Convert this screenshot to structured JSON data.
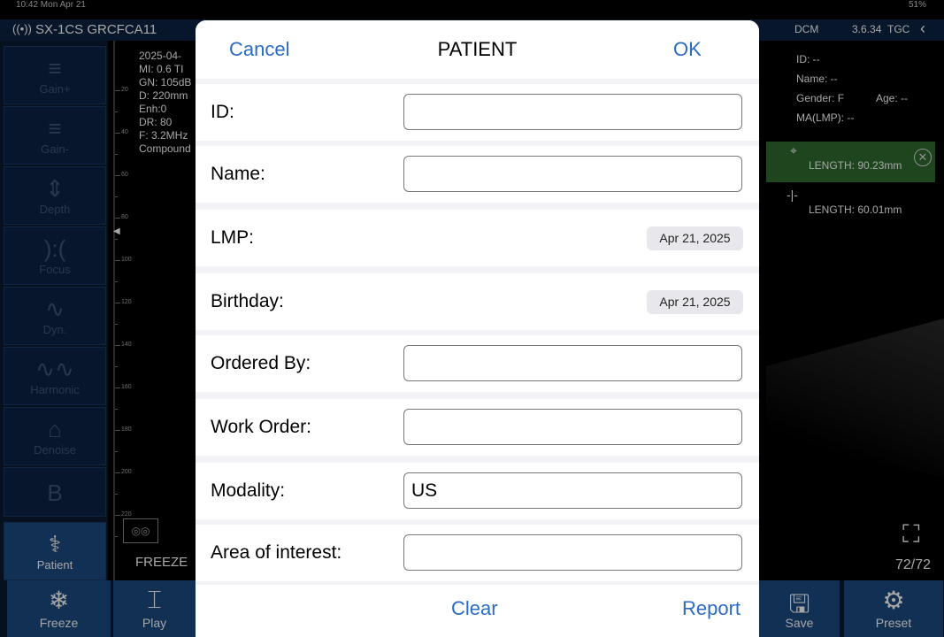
{
  "status_bar": {
    "time": "10:42  Mon Apr 21",
    "battery": "51%"
  },
  "topbar": {
    "device": "SX-1CS GRCFCA11",
    "dcm": "DCM",
    "version": "3.6.34",
    "tgc": "TGC"
  },
  "left_buttons": [
    {
      "label": "Gain+",
      "icon": "gain-plus-icon",
      "glyph": "≡"
    },
    {
      "label": "Gain-",
      "icon": "gain-minus-icon",
      "glyph": "≡"
    },
    {
      "label": "Depth",
      "icon": "depth-icon",
      "glyph": "⇕"
    },
    {
      "label": "Focus",
      "icon": "focus-icon",
      "glyph": "):("
    },
    {
      "label": "Dyn.",
      "icon": "dynamic-range-icon",
      "glyph": "∿"
    },
    {
      "label": "Harmonic",
      "icon": "harmonic-icon",
      "glyph": "∿∿"
    },
    {
      "label": "Denoise",
      "icon": "denoise-icon",
      "glyph": "⌂"
    },
    {
      "label": "B",
      "icon": "b-mode-icon",
      "glyph": "B"
    },
    {
      "label": "Patient",
      "icon": "patient-icon",
      "glyph": "⚕"
    }
  ],
  "scan_params": {
    "date": "2025-04-",
    "mi_ti": "MI: 0.6  TI",
    "gn": "GN: 105dB",
    "d": "D: 220mm",
    "enh": "Enh:0",
    "dr": "DR: 80",
    "f": "F: 3.2MHz",
    "compound": "Compound"
  },
  "ruler_labels": [
    "20",
    "40",
    "60",
    "80",
    "100",
    "120",
    "140",
    "160",
    "180",
    "200",
    "220"
  ],
  "freeze_status": "FREEZE",
  "patient_info": {
    "id": "ID: --",
    "name": "Name: --",
    "gender": "Gender: F",
    "age": "Age: --",
    "ma": "MA(LMP): --"
  },
  "measurements": [
    {
      "symbol": "-̵○-",
      "text": "LENGTH: 90.23mm"
    },
    {
      "symbol": "-|-",
      "text": "LENGTH: 60.01mm"
    }
  ],
  "frame_counter": "72/72",
  "bottom_buttons": [
    {
      "label": "Freeze",
      "icon": "snowflake-icon",
      "glyph": "❄"
    },
    {
      "label": "Play",
      "icon": "play-icon",
      "glyph": "⌶"
    },
    {
      "label": "Save",
      "icon": "save-icon",
      "glyph": "🖫"
    },
    {
      "label": "Preset",
      "icon": "gear-icon",
      "glyph": "⚙"
    }
  ],
  "modal": {
    "cancel": "Cancel",
    "title": "PATIENT",
    "ok": "OK",
    "fields": {
      "id": {
        "label": "ID:",
        "value": ""
      },
      "name": {
        "label": "Name:",
        "value": ""
      },
      "lmp": {
        "label": "LMP:",
        "value": "Apr 21, 2025"
      },
      "birthday": {
        "label": "Birthday:",
        "value": "Apr 21, 2025"
      },
      "ordered_by": {
        "label": "Ordered By:",
        "value": ""
      },
      "work_order": {
        "label": "Work Order:",
        "value": ""
      },
      "modality": {
        "label": "Modality:",
        "value": "US"
      },
      "area": {
        "label": "Area of interest:",
        "value": ""
      }
    },
    "clear": "Clear",
    "report": "Report"
  }
}
